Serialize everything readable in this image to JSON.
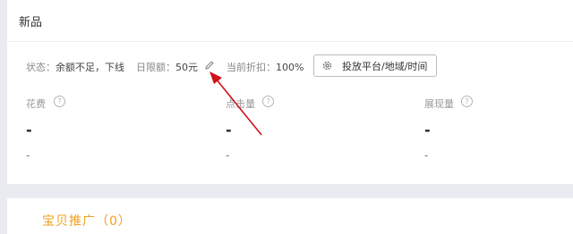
{
  "header": {
    "title": "新品"
  },
  "status_bar": {
    "status_label": "状态：",
    "status_value": "余额不足，下线",
    "budget_label": "日限额：",
    "budget_value": "50元",
    "discount_label": "当前折扣：",
    "discount_value": "100%",
    "platform_button_label": "投放平台/地域/时间"
  },
  "metrics": [
    {
      "label": "花费",
      "value": "-",
      "sub": "-"
    },
    {
      "label": "点击量",
      "value": "-",
      "sub": "-"
    },
    {
      "label": "展现量",
      "value": "-",
      "sub": "-"
    }
  ],
  "help_glyph": "?",
  "bottom_section": {
    "title": "宝贝推广（0）"
  },
  "colors": {
    "accent_orange": "#f0a020",
    "annotation_red": "#d0121b"
  },
  "icons": [
    "pencil-icon",
    "gear-icon",
    "help-icon"
  ]
}
